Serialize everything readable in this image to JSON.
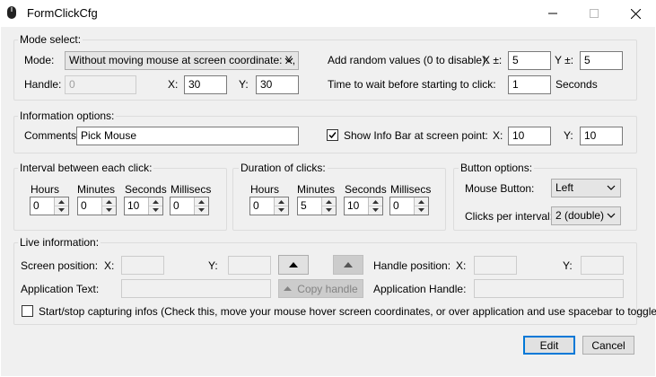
{
  "window": {
    "title": "FormClickCfg",
    "minimize_icon": "minimize-icon",
    "maximize_icon": "maximize-icon",
    "close_icon": "close-icon"
  },
  "mode_select": {
    "group_label": "Mode select:",
    "mode_label": "Mode:",
    "mode_value": "Without moving mouse at screen coordinate: X, Y",
    "handle_label": "Handle:",
    "handle_value": "0",
    "x_label": "X:",
    "x_value": "30",
    "y_label": "Y:",
    "y_value": "30",
    "random_label": "Add random values (0 to disable):",
    "random_x_label": "X ±:",
    "random_x_value": "5",
    "random_y_label": "Y ±:",
    "random_y_value": "5",
    "wait_label": "Time to wait before starting to click:",
    "wait_value": "1",
    "wait_unit": "Seconds"
  },
  "info_options": {
    "group_label": "Information options:",
    "comments_label": "Comments:",
    "comments_value": "Pick Mouse",
    "show_info_label": "Show Info Bar at screen point:",
    "show_info_checked": true,
    "x_label": "X:",
    "x_value": "10",
    "y_label": "Y:",
    "y_value": "10"
  },
  "interval": {
    "group_label": "Interval between each click:",
    "hours_label": "Hours",
    "hours_value": "0",
    "minutes_label": "Minutes",
    "minutes_value": "0",
    "seconds_label": "Seconds",
    "seconds_value": "10",
    "millisecs_label": "Millisecs",
    "millisecs_value": "0"
  },
  "duration": {
    "group_label": "Duration of clicks:",
    "hours_label": "Hours",
    "hours_value": "0",
    "minutes_label": "Minutes",
    "minutes_value": "5",
    "seconds_label": "Seconds",
    "seconds_value": "10",
    "millisecs_label": "Millisecs",
    "millisecs_value": "0"
  },
  "button_options": {
    "group_label": "Button options:",
    "mouse_button_label": "Mouse Button:",
    "mouse_button_value": "Left",
    "clicks_label": "Clicks per interval:",
    "clicks_value": "2 (double)"
  },
  "live_info": {
    "group_label": "Live information:",
    "screen_position_label": "Screen position:",
    "x_label": "X:",
    "y_label": "Y:",
    "handle_position_label": "Handle position:",
    "handle_x_label": "X:",
    "handle_y_label": "Y:",
    "app_text_label": "Application Text:",
    "copy_handle_label": "Copy handle",
    "app_handle_label": "Application Handle:",
    "capture_label": "Start/stop capturing infos (Check this, move your mouse hover screen coordinates, or over application and use spacebar to toggle)",
    "capture_checked": false
  },
  "footer": {
    "edit_label": "Edit",
    "cancel_label": "Cancel"
  },
  "colors": {
    "accent": "#0078d7",
    "background": "#f0f0f0"
  }
}
